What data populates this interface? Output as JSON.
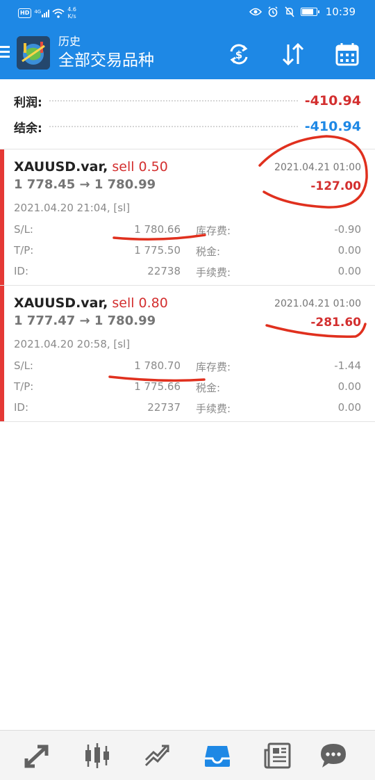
{
  "status_bar": {
    "network_type": "4G",
    "hd_badge": "HD",
    "speed_value": "4.6",
    "speed_unit": "K/s",
    "time": "10:39",
    "battery_level": 0.85
  },
  "app_bar": {
    "title": "历史",
    "subtitle": "全部交易品种"
  },
  "summary": {
    "profit_label": "利润:",
    "profit_value": "-410.94",
    "balance_label": "结余:",
    "balance_value": "-410.94"
  },
  "trades": [
    {
      "symbol": "XAUUSD.var,",
      "side_volume": "sell 0.50",
      "prices": "1 778.45 → 1 780.99",
      "close_time": "2021.04.21 01:00",
      "profit": "-127.00",
      "open_info": "2021.04.20 21:04, [sl]",
      "sl_label": "S/L:",
      "sl_value": "1 780.66",
      "swap_label": "库存费:",
      "swap_value": "-0.90",
      "tp_label": "T/P:",
      "tp_value": "1 775.50",
      "tax_label": "税金:",
      "tax_value": "0.00",
      "id_label": "ID:",
      "id_value": "22738",
      "fee_label": "手续费:",
      "fee_value": "0.00"
    },
    {
      "symbol": "XAUUSD.var,",
      "side_volume": "sell 0.80",
      "prices": "1 777.47 → 1 780.99",
      "close_time": "2021.04.21 01:00",
      "profit": "-281.60",
      "open_info": "2021.04.20 20:58, [sl]",
      "sl_label": "S/L:",
      "sl_value": "1 780.70",
      "swap_label": "库存费:",
      "swap_value": "-1.44",
      "tp_label": "T/P:",
      "tp_value": "1 775.66",
      "tax_label": "税金:",
      "tax_value": "0.00",
      "id_label": "ID:",
      "id_value": "22737",
      "fee_label": "手续费:",
      "fee_value": "0.00"
    }
  ],
  "colors": {
    "primary": "#1e88e5",
    "loss": "#d32f2f",
    "balance": "#1e88e5",
    "annotation": "#e0301e"
  },
  "icons": {
    "appbar": [
      "menu-icon",
      "app-logo",
      "currency-exchange-icon",
      "sort-icon",
      "calendar-icon"
    ],
    "bottom_nav": [
      "quotes-icon",
      "chart-icon",
      "trade-icon",
      "history-icon",
      "news-icon",
      "chat-icon"
    ],
    "active_nav": "history-icon"
  }
}
